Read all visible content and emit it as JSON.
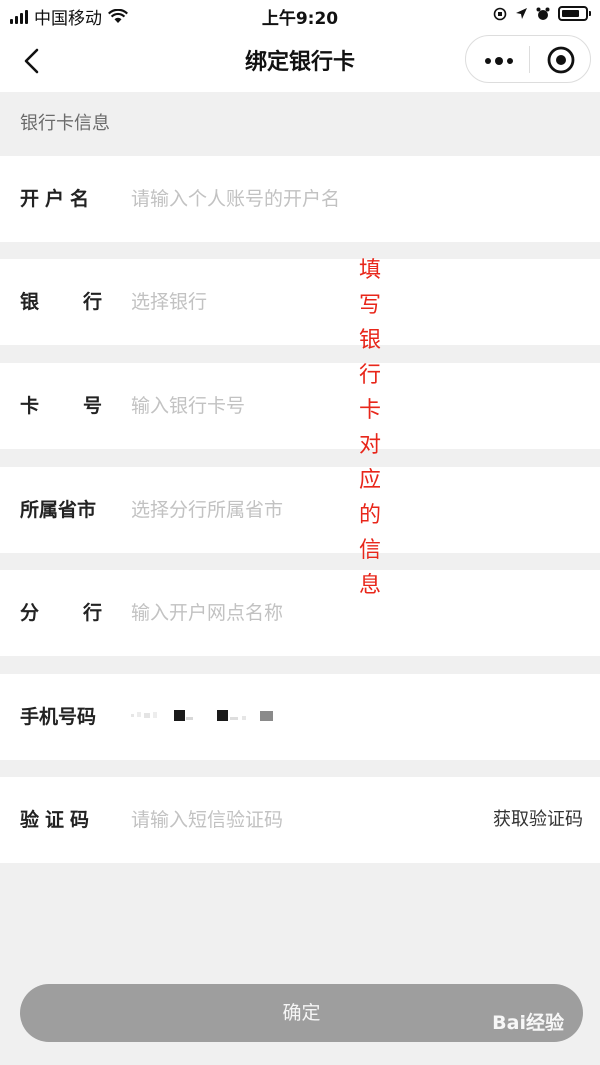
{
  "status_bar": {
    "carrier": "中国移动",
    "time": "上午9:20"
  },
  "nav": {
    "title": "绑定银行卡",
    "back_icon": "chevron-left-icon",
    "more_icon": "more-dots-icon",
    "close_icon": "target-circle-icon"
  },
  "section": {
    "title": "银行卡信息"
  },
  "form": {
    "account_name": {
      "label": "开户名",
      "placeholder": "请输入个人账号的开户名"
    },
    "bank": {
      "label": "银行",
      "placeholder": "选择银行"
    },
    "card_number": {
      "label": "卡号",
      "placeholder": "输入银行卡号"
    },
    "province": {
      "label": "所属省市",
      "placeholder": "选择分行所属省市"
    },
    "branch": {
      "label": "分行",
      "placeholder": "输入开户网点名称"
    },
    "phone": {
      "label": "手机号码",
      "masked": true
    },
    "code": {
      "label": "验证码",
      "placeholder": "请输入短信验证码",
      "action": "获取验证码"
    }
  },
  "annotation": "填写银行卡对应的信息",
  "confirm_label": "确定",
  "watermark": "Bai经验",
  "colors": {
    "annotation": "#e8261a",
    "button": "#9e9e9e",
    "placeholder": "#c2c2c2",
    "background": "#f0f0f0"
  }
}
